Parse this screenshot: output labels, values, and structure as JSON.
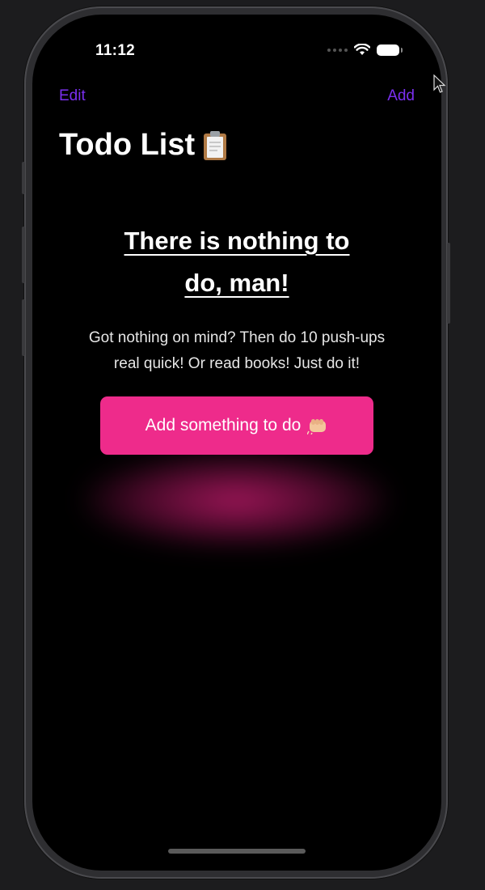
{
  "status_bar": {
    "time": "11:12",
    "icons": [
      "signal-dots-icon",
      "wifi-icon",
      "battery-icon"
    ]
  },
  "nav": {
    "edit_label": "Edit",
    "add_label": "Add",
    "accent_color": "#7b2ff0"
  },
  "page": {
    "title": "Todo List",
    "title_icon": "clipboard-icon"
  },
  "empty_state": {
    "heading_line1": "There is nothing to",
    "heading_line2": "do, man!",
    "subtitle": "Got nothing on mind? Then do 10 push-ups real quick! Or read books! Just do it!",
    "button_label": "Add something to do",
    "button_icon": "fist-bump-icon",
    "button_color": "#ee2b8b"
  }
}
